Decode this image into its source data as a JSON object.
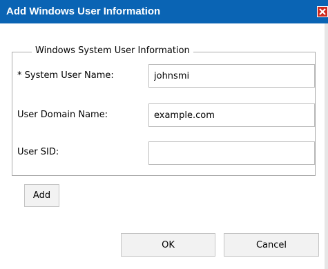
{
  "dialog": {
    "title": "Add Windows User Information",
    "close_icon": "close-x-icon"
  },
  "group": {
    "legend": "Windows System User Information"
  },
  "fields": {
    "system_user_name": {
      "label": "* System User Name:",
      "value": "johnsmi"
    },
    "user_domain_name": {
      "label": "User Domain Name:",
      "value": "example.com"
    },
    "user_sid": {
      "label": "User SID:",
      "value": ""
    }
  },
  "buttons": {
    "add_label": "Add",
    "ok_label": "OK",
    "cancel_label": "Cancel"
  },
  "colors": {
    "titlebar": "#0a64b4",
    "close_button": "#cf2a1e"
  }
}
